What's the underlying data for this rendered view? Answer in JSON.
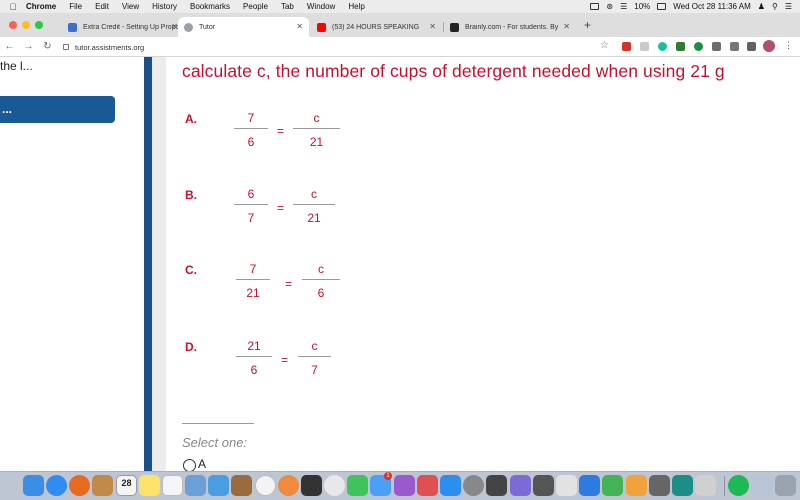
{
  "menubar": {
    "items": [
      "Chrome",
      "File",
      "Edit",
      "View",
      "History",
      "Bookmarks",
      "People",
      "Tab",
      "Window",
      "Help"
    ],
    "battery": "10%",
    "datetime": "Wed Oct 28  11:36 AM"
  },
  "tabs": [
    {
      "title": "Extra Credit - Setting Up Propo",
      "favicon_color": "#3b6fd4"
    },
    {
      "title": "Tutor",
      "favicon_color": "#9aa0a6"
    },
    {
      "title": "(53) 24 HOURS SPEAKING",
      "favicon_color": "#ff0000"
    },
    {
      "title": "Brainly.com - For students. By",
      "favicon_color": "#222222"
    }
  ],
  "address": {
    "url": "tutor.assistments.org"
  },
  "sidebar": {
    "text": "the l...",
    "button_label": "..."
  },
  "question": {
    "text": "calculate c, the number of cups of detergent needed when using 21 g"
  },
  "options": [
    {
      "letter": "A.",
      "left_num": "7",
      "left_den": "6",
      "equals": "=",
      "right_num": "c",
      "right_den": "21"
    },
    {
      "letter": "B.",
      "left_num": "6",
      "left_den": "7",
      "equals": "=",
      "right_num": "c",
      "right_den": "21"
    },
    {
      "letter": "C.",
      "left_num": "7",
      "left_den": "21",
      "equals": "=",
      "right_num": "c",
      "right_den": "6"
    },
    {
      "letter": "D.",
      "left_num": "21",
      "left_den": "6",
      "equals": "=",
      "right_num": "c",
      "right_den": "7"
    }
  ],
  "answer": {
    "prompt": "Select one:",
    "first_choice_label": "A"
  },
  "dock": {
    "calendar_day": "28",
    "badge_count": "1",
    "colors": {
      "accent_red": "#c8102e",
      "nav_blue": "#1b4f8a"
    }
  }
}
